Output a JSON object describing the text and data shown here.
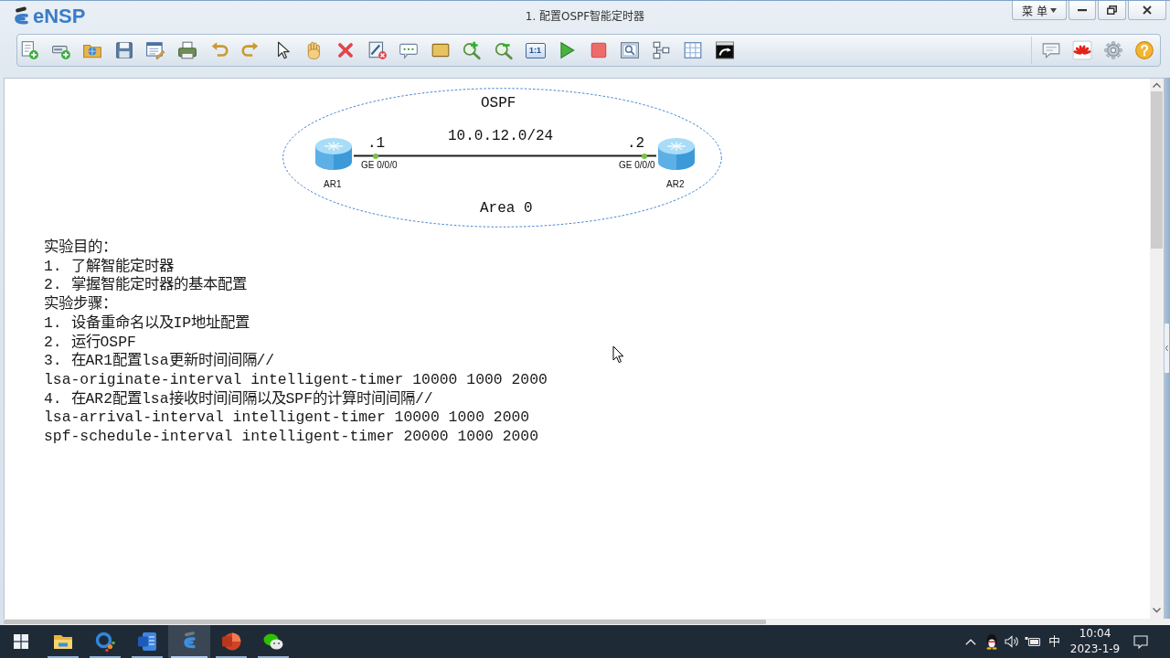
{
  "window": {
    "app_name": "eNSP",
    "title": "1. 配置OSPF智能定时器",
    "menu_label": "菜 单"
  },
  "toolbar": {
    "actual_size_label": "1:1"
  },
  "topology": {
    "protocol_label": "OSPF",
    "subnet": "10.0.12.0/24",
    "area_label": "Area 0",
    "devices": [
      {
        "name": "AR1",
        "address_suffix": ".1",
        "interface": "GE 0/0/0",
        "port_up": true
      },
      {
        "name": "AR2",
        "address_suffix": ".2",
        "interface": "GE 0/0/0",
        "port_up": true
      }
    ],
    "notes": [
      "实验目的：",
      "1. 了解智能定时器",
      "2. 掌握智能定时器的基本配置",
      "实验步骤：",
      "1. 设备重命名以及IP地址配置",
      "2. 运行OSPF",
      "3. 在AR1配置lsa更新时间间隔//",
      "lsa-originate-interval intelligent-timer 10000 1000 2000",
      "4. 在AR2配置lsa接收时间间隔以及SPF的计算时间间隔//",
      "lsa-arrival-interval intelligent-timer 10000 1000 2000",
      "spf-schedule-interval intelligent-timer 20000 1000 2000"
    ]
  },
  "taskbar": {
    "apps": [
      {
        "kind": "explorer",
        "running": true,
        "selected": false
      },
      {
        "kind": "browser",
        "running": true,
        "selected": false
      },
      {
        "kind": "word",
        "running": true,
        "selected": false
      },
      {
        "kind": "ensp",
        "running": true,
        "selected": true
      },
      {
        "kind": "powerpoint",
        "running": true,
        "selected": false
      },
      {
        "kind": "wechat",
        "running": true,
        "selected": false
      }
    ],
    "input_method": "中",
    "time": "10:04",
    "date": "2023-1-9"
  }
}
